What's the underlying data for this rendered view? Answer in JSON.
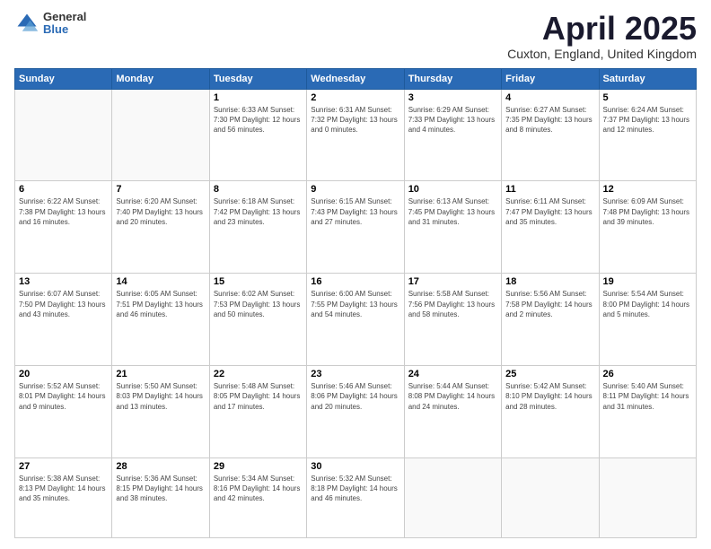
{
  "logo": {
    "general": "General",
    "blue": "Blue"
  },
  "header": {
    "title": "April 2025",
    "location": "Cuxton, England, United Kingdom"
  },
  "days_of_week": [
    "Sunday",
    "Monday",
    "Tuesday",
    "Wednesday",
    "Thursday",
    "Friday",
    "Saturday"
  ],
  "weeks": [
    [
      {
        "day": "",
        "info": ""
      },
      {
        "day": "",
        "info": ""
      },
      {
        "day": "1",
        "info": "Sunrise: 6:33 AM\nSunset: 7:30 PM\nDaylight: 12 hours\nand 56 minutes."
      },
      {
        "day": "2",
        "info": "Sunrise: 6:31 AM\nSunset: 7:32 PM\nDaylight: 13 hours\nand 0 minutes."
      },
      {
        "day": "3",
        "info": "Sunrise: 6:29 AM\nSunset: 7:33 PM\nDaylight: 13 hours\nand 4 minutes."
      },
      {
        "day": "4",
        "info": "Sunrise: 6:27 AM\nSunset: 7:35 PM\nDaylight: 13 hours\nand 8 minutes."
      },
      {
        "day": "5",
        "info": "Sunrise: 6:24 AM\nSunset: 7:37 PM\nDaylight: 13 hours\nand 12 minutes."
      }
    ],
    [
      {
        "day": "6",
        "info": "Sunrise: 6:22 AM\nSunset: 7:38 PM\nDaylight: 13 hours\nand 16 minutes."
      },
      {
        "day": "7",
        "info": "Sunrise: 6:20 AM\nSunset: 7:40 PM\nDaylight: 13 hours\nand 20 minutes."
      },
      {
        "day": "8",
        "info": "Sunrise: 6:18 AM\nSunset: 7:42 PM\nDaylight: 13 hours\nand 23 minutes."
      },
      {
        "day": "9",
        "info": "Sunrise: 6:15 AM\nSunset: 7:43 PM\nDaylight: 13 hours\nand 27 minutes."
      },
      {
        "day": "10",
        "info": "Sunrise: 6:13 AM\nSunset: 7:45 PM\nDaylight: 13 hours\nand 31 minutes."
      },
      {
        "day": "11",
        "info": "Sunrise: 6:11 AM\nSunset: 7:47 PM\nDaylight: 13 hours\nand 35 minutes."
      },
      {
        "day": "12",
        "info": "Sunrise: 6:09 AM\nSunset: 7:48 PM\nDaylight: 13 hours\nand 39 minutes."
      }
    ],
    [
      {
        "day": "13",
        "info": "Sunrise: 6:07 AM\nSunset: 7:50 PM\nDaylight: 13 hours\nand 43 minutes."
      },
      {
        "day": "14",
        "info": "Sunrise: 6:05 AM\nSunset: 7:51 PM\nDaylight: 13 hours\nand 46 minutes."
      },
      {
        "day": "15",
        "info": "Sunrise: 6:02 AM\nSunset: 7:53 PM\nDaylight: 13 hours\nand 50 minutes."
      },
      {
        "day": "16",
        "info": "Sunrise: 6:00 AM\nSunset: 7:55 PM\nDaylight: 13 hours\nand 54 minutes."
      },
      {
        "day": "17",
        "info": "Sunrise: 5:58 AM\nSunset: 7:56 PM\nDaylight: 13 hours\nand 58 minutes."
      },
      {
        "day": "18",
        "info": "Sunrise: 5:56 AM\nSunset: 7:58 PM\nDaylight: 14 hours\nand 2 minutes."
      },
      {
        "day": "19",
        "info": "Sunrise: 5:54 AM\nSunset: 8:00 PM\nDaylight: 14 hours\nand 5 minutes."
      }
    ],
    [
      {
        "day": "20",
        "info": "Sunrise: 5:52 AM\nSunset: 8:01 PM\nDaylight: 14 hours\nand 9 minutes."
      },
      {
        "day": "21",
        "info": "Sunrise: 5:50 AM\nSunset: 8:03 PM\nDaylight: 14 hours\nand 13 minutes."
      },
      {
        "day": "22",
        "info": "Sunrise: 5:48 AM\nSunset: 8:05 PM\nDaylight: 14 hours\nand 17 minutes."
      },
      {
        "day": "23",
        "info": "Sunrise: 5:46 AM\nSunset: 8:06 PM\nDaylight: 14 hours\nand 20 minutes."
      },
      {
        "day": "24",
        "info": "Sunrise: 5:44 AM\nSunset: 8:08 PM\nDaylight: 14 hours\nand 24 minutes."
      },
      {
        "day": "25",
        "info": "Sunrise: 5:42 AM\nSunset: 8:10 PM\nDaylight: 14 hours\nand 28 minutes."
      },
      {
        "day": "26",
        "info": "Sunrise: 5:40 AM\nSunset: 8:11 PM\nDaylight: 14 hours\nand 31 minutes."
      }
    ],
    [
      {
        "day": "27",
        "info": "Sunrise: 5:38 AM\nSunset: 8:13 PM\nDaylight: 14 hours\nand 35 minutes."
      },
      {
        "day": "28",
        "info": "Sunrise: 5:36 AM\nSunset: 8:15 PM\nDaylight: 14 hours\nand 38 minutes."
      },
      {
        "day": "29",
        "info": "Sunrise: 5:34 AM\nSunset: 8:16 PM\nDaylight: 14 hours\nand 42 minutes."
      },
      {
        "day": "30",
        "info": "Sunrise: 5:32 AM\nSunset: 8:18 PM\nDaylight: 14 hours\nand 46 minutes."
      },
      {
        "day": "",
        "info": ""
      },
      {
        "day": "",
        "info": ""
      },
      {
        "day": "",
        "info": ""
      }
    ]
  ]
}
